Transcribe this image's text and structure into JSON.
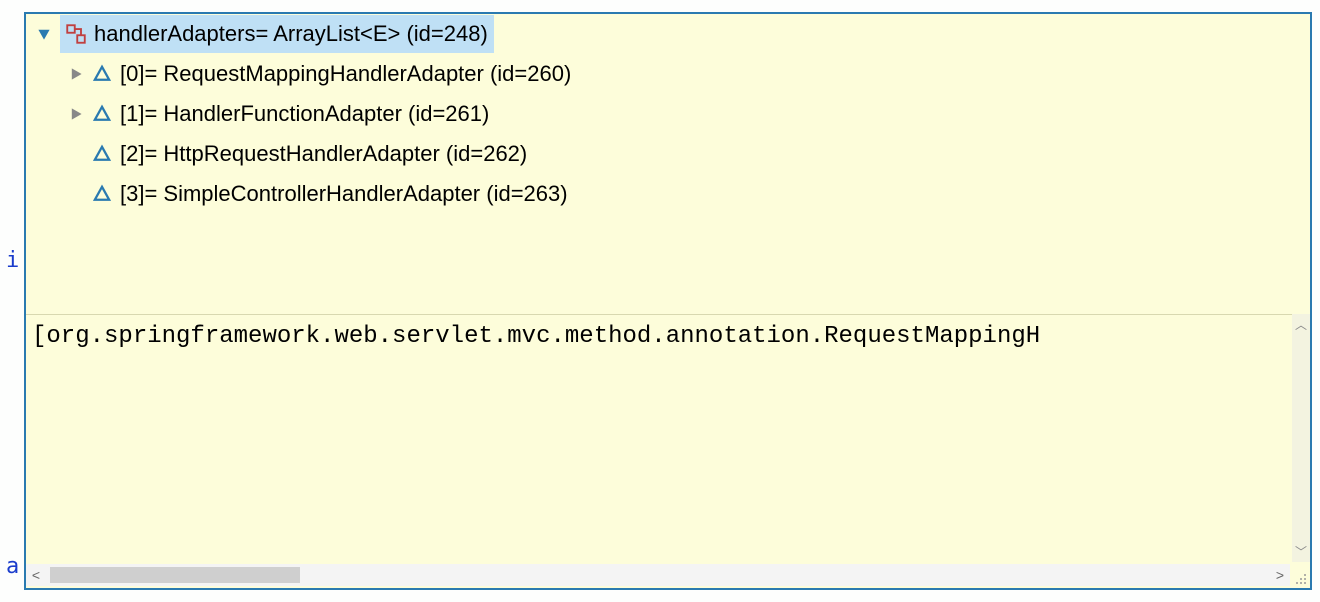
{
  "gutter": {
    "char1": "i",
    "char2": "a"
  },
  "root": {
    "name": "handlerAdapters",
    "type": "ArrayList<E>",
    "id": "248",
    "label_full": "handlerAdapters= ArrayList<E>  (id=248)"
  },
  "items": [
    {
      "index": "[0]",
      "type": "RequestMappingHandlerAdapter",
      "id": "260",
      "expandable": true,
      "label_full": "[0]= RequestMappingHandlerAdapter  (id=260)"
    },
    {
      "index": "[1]",
      "type": "HandlerFunctionAdapter",
      "id": "261",
      "expandable": true,
      "label_full": "[1]= HandlerFunctionAdapter  (id=261)"
    },
    {
      "index": "[2]",
      "type": "HttpRequestHandlerAdapter",
      "id": "262",
      "expandable": false,
      "label_full": "[2]= HttpRequestHandlerAdapter  (id=262)"
    },
    {
      "index": "[3]",
      "type": "SimpleControllerHandlerAdapter",
      "id": "263",
      "expandable": false,
      "label_full": "[3]= SimpleControllerHandlerAdapter  (id=263)"
    }
  ],
  "detail": "[org.springframework.web.servlet.mvc.method.annotation.RequestMappingH"
}
